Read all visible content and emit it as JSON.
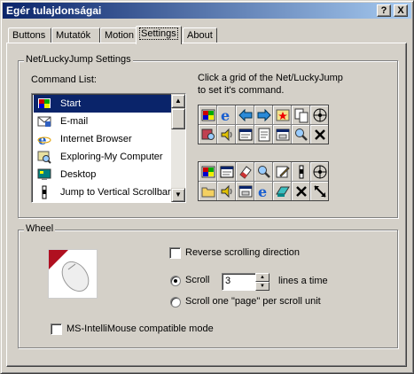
{
  "window": {
    "title": "Egér tulajdonságai",
    "help_btn": "?",
    "close_btn": "X"
  },
  "tabs": [
    {
      "label": "Buttons"
    },
    {
      "label": "Mutatók"
    },
    {
      "label": "Motion"
    },
    {
      "label": "Settings",
      "active": true
    },
    {
      "label": "About"
    }
  ],
  "netgroup": {
    "title": "Net/LuckyJump Settings",
    "command_list_label": "Command List:",
    "items": [
      {
        "label": "Start",
        "icon": "start-icon",
        "selected": true
      },
      {
        "label": "E-mail",
        "icon": "email-icon"
      },
      {
        "label": "Internet Browser",
        "icon": "ie-icon"
      },
      {
        "label": "Exploring-My Computer",
        "icon": "explorer-icon"
      },
      {
        "label": "Desktop",
        "icon": "desktop-icon"
      },
      {
        "label": "Jump to Vertical Scrollbar",
        "icon": "scrollbar-icon"
      }
    ],
    "hint_line1": "Click a grid of the Net/LuckyJump",
    "hint_line2": "to set it's command.",
    "grid1_icons": [
      "start",
      "ie",
      "back",
      "forward",
      "favorites",
      "copy",
      "move",
      "explorer",
      "sound",
      "window",
      "file",
      "dialog",
      "search",
      "close"
    ],
    "grid2_icons": [
      "start",
      "window",
      "eraser",
      "search",
      "edit",
      "scrollbar",
      "move",
      "folder",
      "sound",
      "dialog",
      "ie",
      "paste",
      "close",
      "resize"
    ]
  },
  "wheel": {
    "title": "Wheel",
    "reverse_label": "Reverse scrolling direction",
    "reverse_checked": false,
    "scroll_label": "Scroll",
    "scroll_value": "3",
    "lines_label": "lines a time",
    "page_label": "Scroll one \"page\" per scroll unit",
    "scroll_mode": "lines",
    "intellimouse_label": "MS-IntelliMouse compatible mode",
    "intellimouse_checked": false
  },
  "colors": {
    "selection": "#0a246a",
    "titlebar_start": "#0a246a",
    "titlebar_end": "#a6caf0",
    "face": "#d4d0c8"
  }
}
